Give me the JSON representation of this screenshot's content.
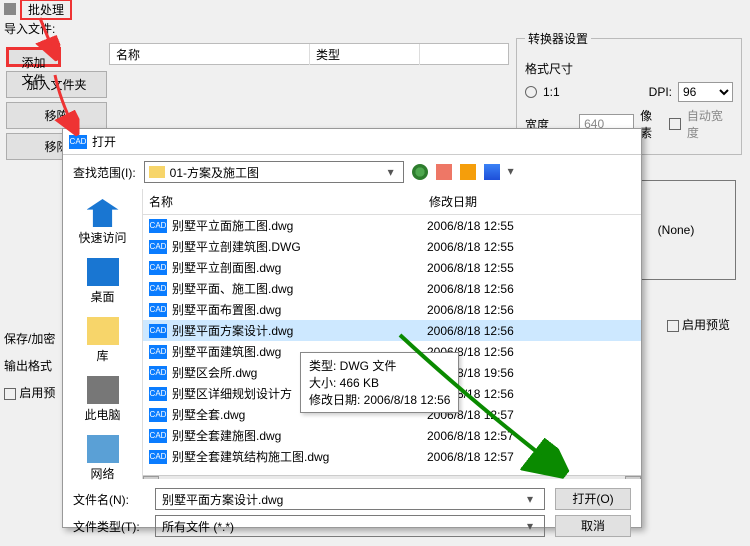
{
  "window_title": "批处理",
  "import_label": "导入文件:",
  "buttons": {
    "add_file": "添加文件",
    "add_folder": "加入文件夹",
    "move": "移陈",
    "move2": "移陈"
  },
  "file_list_headers": {
    "name": "名称",
    "type": "类型"
  },
  "settings": {
    "legend": "转换器设置",
    "format_label": "格式尺寸",
    "ratio": "1:1",
    "dpi_label": "DPI:",
    "dpi_value": "96",
    "width_label": "宽度",
    "width_value": "640",
    "px_label": "像素",
    "auto_width": "自动宽度"
  },
  "preview_none": "(None)",
  "enable_preview": "启用预览",
  "left_labels": {
    "save": "保存/加密",
    "output": "输出格式",
    "enable_pre": "启用预"
  },
  "dialog": {
    "title": "打开",
    "lookin_label": "查找范围(I):",
    "folder": "01-方案及施工图",
    "columns": {
      "name": "名称",
      "date": "修改日期"
    },
    "places": {
      "qa": "快速访问",
      "desktop": "桌面",
      "lib": "库",
      "pc": "此电脑",
      "net": "网络"
    },
    "files": [
      {
        "name": "别墅平立面施工图.dwg",
        "date": "2006/8/18 12:55"
      },
      {
        "name": "别墅平立剖建筑图.DWG",
        "date": "2006/8/18 12:55"
      },
      {
        "name": "别墅平立剖面图.dwg",
        "date": "2006/8/18 12:55"
      },
      {
        "name": "别墅平面、施工图.dwg",
        "date": "2006/8/18 12:56"
      },
      {
        "name": "别墅平面布置图.dwg",
        "date": "2006/8/18 12:56"
      },
      {
        "name": "别墅平面方案设计.dwg",
        "date": "2006/8/18 12:56",
        "selected": true
      },
      {
        "name": "别墅平面建筑图.dwg",
        "date": "2006/8/18 12:56"
      },
      {
        "name": "别墅区会所.dwg",
        "date": "2006/8/18 19:56"
      },
      {
        "name": "别墅区详细规划设计方",
        "date": "2006/8/18 12:56"
      },
      {
        "name": "别墅全套.dwg",
        "date": "2006/8/18 12:57"
      },
      {
        "name": "别墅全套建施图.dwg",
        "date": "2006/8/18 12:57"
      },
      {
        "name": "别墅全套建筑结构施工图.dwg",
        "date": "2006/8/18 12:57"
      }
    ],
    "tooltip": {
      "type_line": "类型: DWG 文件",
      "size_line": "大小: 466 KB",
      "date_line": "修改日期: 2006/8/18 12:56"
    },
    "filename_label": "文件名(N):",
    "filename_value": "别墅平面方案设计.dwg",
    "filetype_label": "文件类型(T):",
    "filetype_value": "所有文件 (*.*)",
    "open_btn": "打开(O)",
    "cancel_btn": "取消"
  }
}
